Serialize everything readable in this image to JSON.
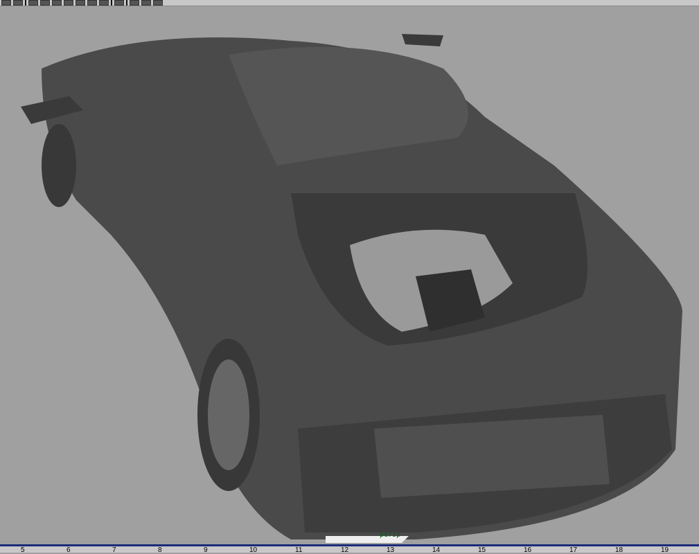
{
  "shelf": {
    "icons": [
      "render-icon",
      "display-icon",
      "wireframe-icon",
      "smooth-shade-icon",
      "flat-shade-icon",
      "texture-icon",
      "light-icon",
      "ambient-light-icon",
      "material-icon",
      "axis-icon",
      "camera-icon",
      "film-gate-icon",
      "resolution-gate-icon"
    ]
  },
  "viewport": {
    "camera": "persp"
  },
  "timeline": {
    "ticks": [
      "5",
      "6",
      "7",
      "8",
      "9",
      "10",
      "11",
      "12",
      "13",
      "14",
      "15",
      "16",
      "17",
      "18",
      "19"
    ]
  }
}
